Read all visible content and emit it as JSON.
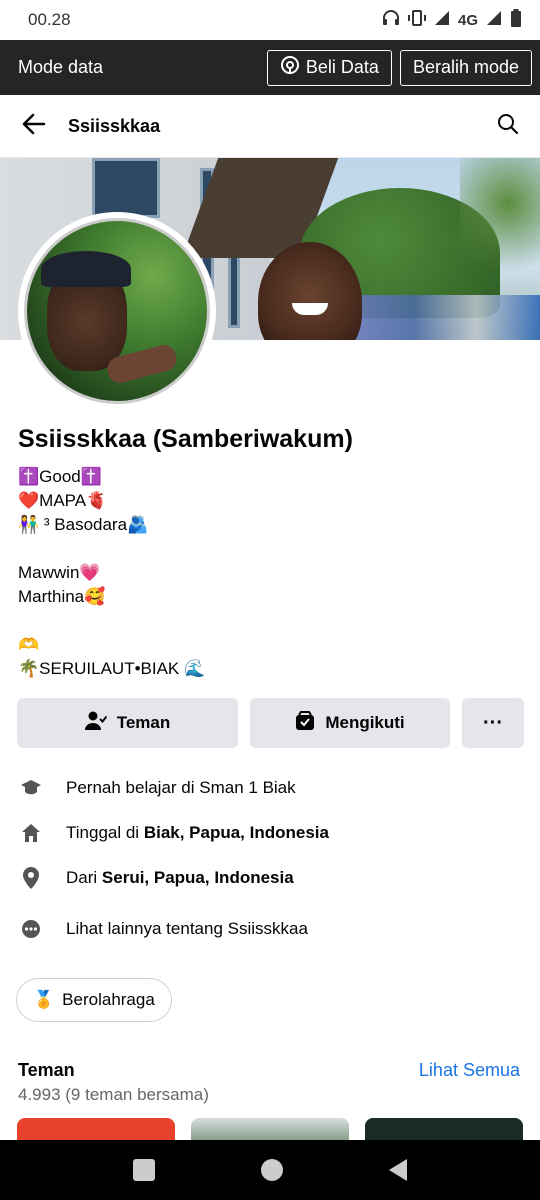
{
  "status_bar": {
    "time": "00.28",
    "network": "4G"
  },
  "data_bar": {
    "title": "Mode data",
    "buy_data_label": "Beli Data",
    "switch_mode_label": "Beralih mode"
  },
  "header": {
    "title": "Ssiisskkaa"
  },
  "profile": {
    "name": "Ssiisskkaa (Samberiwakum)",
    "bio": [
      "✝️Good✝️",
      "❤️MAPA🫀",
      "👫 ³ Basodara🫂",
      "",
      "Mawwin💗",
      "Marthina🥰",
      "",
      "🫶",
      "🌴SERUILAUT•BIAK 🌊"
    ]
  },
  "actions": {
    "friend_label": "Teman",
    "following_label": "Mengikuti",
    "more_label": "···"
  },
  "info": {
    "education": "Pernah belajar di Sman 1 Biak",
    "lives_prefix": "Tinggal di ",
    "lives_place": "Biak, Papua, Indonesia",
    "from_prefix": "Dari ",
    "from_place": "Serui, Papua, Indonesia",
    "see_more": "Lihat lainnya tentang Ssiisskkaa"
  },
  "interest_chip": {
    "label": "Berolahraga"
  },
  "friends": {
    "title": "Teman",
    "see_all": "Lihat Semua",
    "count_text": "4.993 (9 teman bersama)"
  },
  "colors": {
    "accent": "#1b74e4",
    "button_bg": "#e4e6eb",
    "data_bar_bg": "#242526"
  }
}
